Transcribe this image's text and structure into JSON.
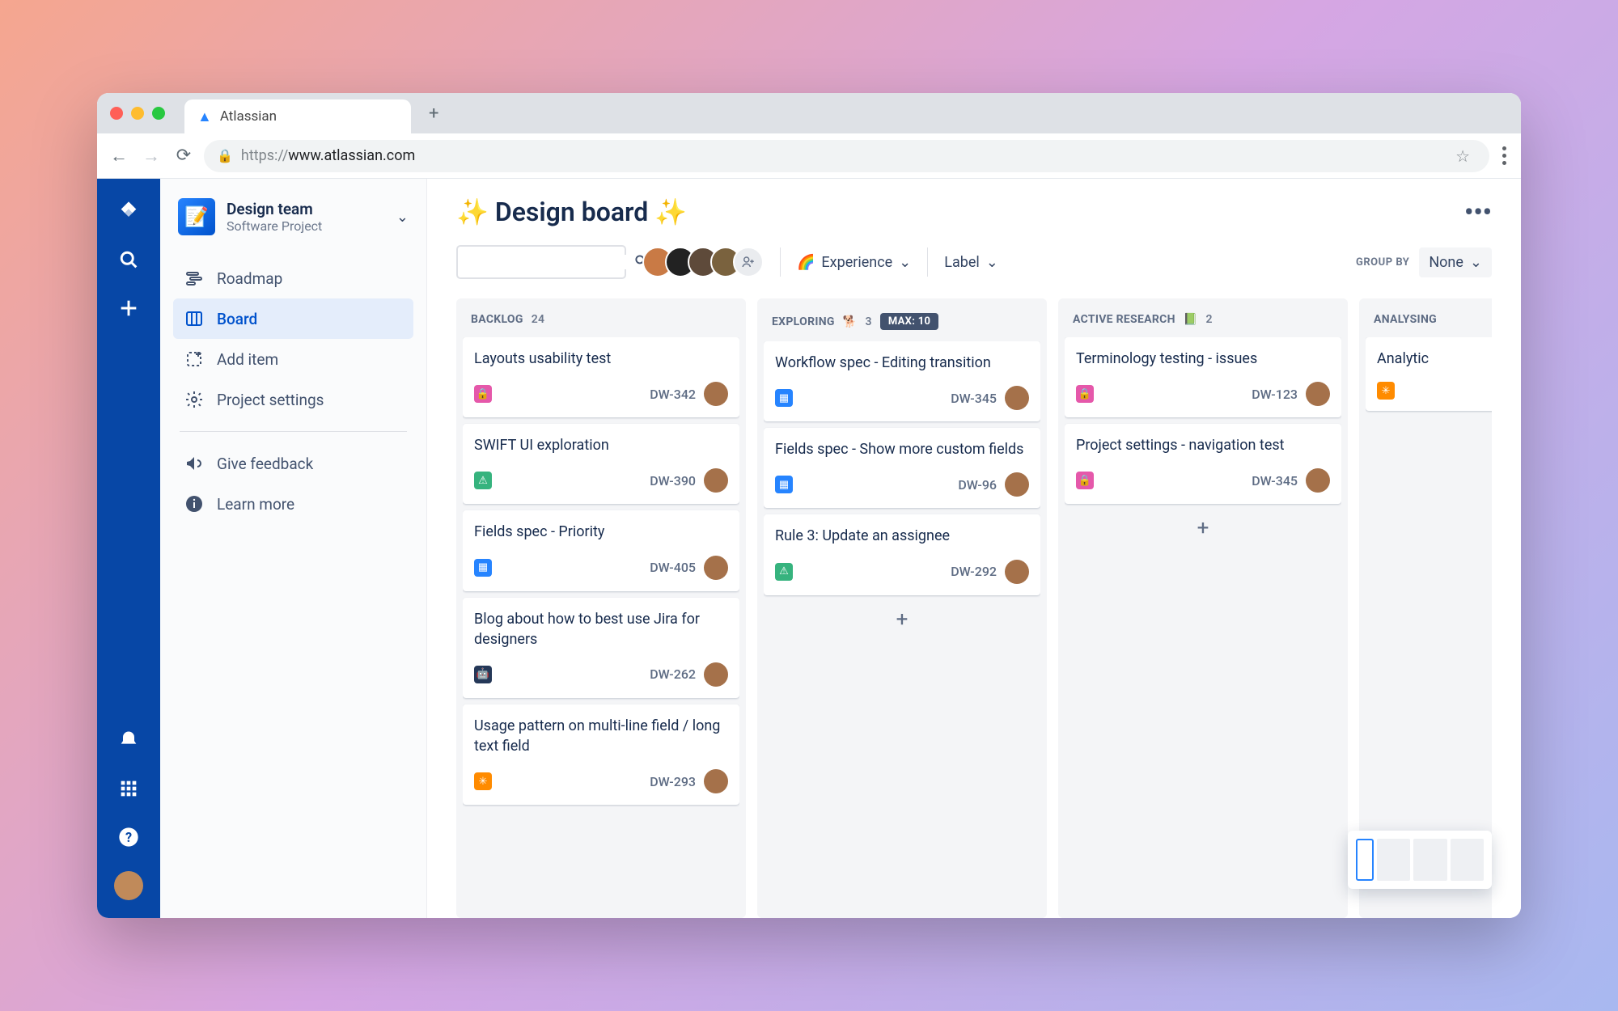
{
  "browser": {
    "tab_title": "Atlassian",
    "url_prefix": "https://",
    "url_domain": "www.atlassian.com"
  },
  "project": {
    "name": "Design team",
    "type": "Software Project",
    "avatar_emoji": "📝"
  },
  "sidebar": {
    "items": [
      {
        "label": "Roadmap"
      },
      {
        "label": "Board"
      },
      {
        "label": "Add item"
      },
      {
        "label": "Project settings"
      }
    ],
    "feedback": "Give feedback",
    "learn": "Learn more"
  },
  "board": {
    "title": "Design board",
    "filters": {
      "experience": "Experience",
      "label_text": "Label"
    },
    "group_by_label": "GROUP BY",
    "group_by_value": "None",
    "columns": [
      {
        "name": "BACKLOG",
        "emoji": "",
        "count": "24",
        "max": null,
        "cards": [
          {
            "title": "Layouts usability test",
            "key": "DW-342",
            "type": "pink"
          },
          {
            "title": "SWIFT UI exploration",
            "key": "DW-390",
            "type": "green"
          },
          {
            "title": "Fields spec - Priority",
            "key": "DW-405",
            "type": "blue"
          },
          {
            "title": "Blog about how to best use Jira for designers",
            "key": "DW-262",
            "type": "dark"
          },
          {
            "title": "Usage pattern on multi-line field / long text field",
            "key": "DW-293",
            "type": "orange"
          }
        ]
      },
      {
        "name": "EXPLORING",
        "emoji": "🐕",
        "count": "3",
        "max": "MAX: 10",
        "cards": [
          {
            "title": "Workflow spec - Editing transition",
            "key": "DW-345",
            "type": "blue"
          },
          {
            "title": "Fields spec - Show more custom fields",
            "key": "DW-96",
            "type": "blue"
          },
          {
            "title": "Rule 3: Update an assignee",
            "key": "DW-292",
            "type": "green"
          }
        ]
      },
      {
        "name": "ACTIVE RESEARCH",
        "emoji": "📗",
        "count": "2",
        "max": null,
        "cards": [
          {
            "title": "Terminology testing - issues",
            "key": "DW-123",
            "type": "pink"
          },
          {
            "title": "Project settings - navigation test",
            "key": "DW-345",
            "type": "pink"
          }
        ]
      },
      {
        "name": "ANALYSING",
        "emoji": "",
        "count": "",
        "max": null,
        "cards": [
          {
            "title": "Analytic",
            "key": "",
            "type": "orange"
          }
        ]
      }
    ]
  }
}
